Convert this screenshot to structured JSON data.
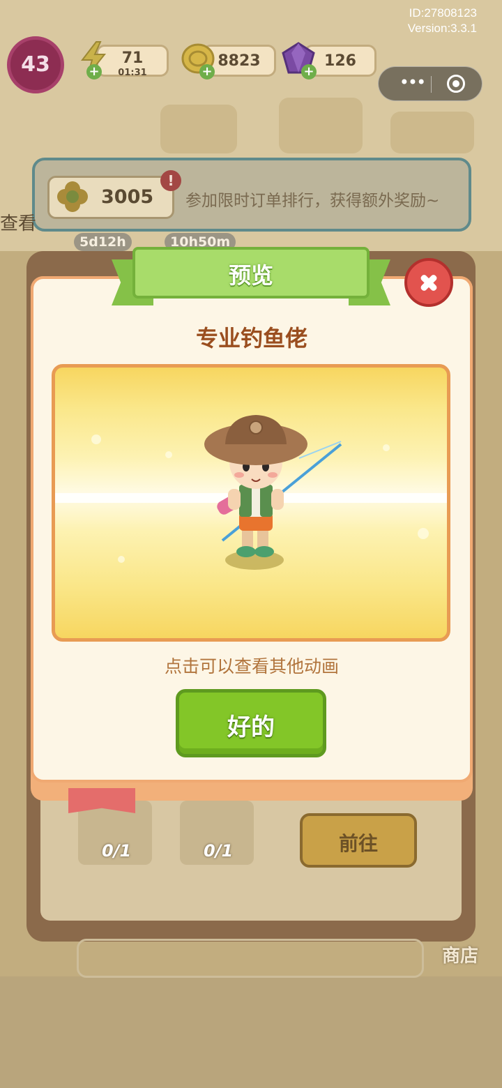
{
  "build": {
    "id": "ID:27808123",
    "version": "Version:3.3.1"
  },
  "hud": {
    "level": "43",
    "energy": "71",
    "energy_timer": "01:31",
    "coins": "8823",
    "gems": "126"
  },
  "mini_program": {
    "more_icon": "more-dots-icon",
    "close_icon": "target-circle-icon"
  },
  "banner": {
    "score": "3005",
    "alert": "!",
    "message": "参加限时订单排行，获得额外奖励~",
    "side_label": "查看",
    "timers": [
      "5d12h",
      "10h50m"
    ]
  },
  "background_panel": {
    "cards": [
      {
        "count": "0/1"
      },
      {
        "count": "0/1"
      }
    ],
    "go_button": "前往",
    "shop_label": "商店"
  },
  "modal": {
    "header": "预览",
    "title": "专业钓鱼佬",
    "hint": "点击可以查看其他动画",
    "ok_button": "好的"
  },
  "colors": {
    "accent_green": "#83c628",
    "modal_border": "#f0a972",
    "title_brown": "#9a4e1f",
    "close_red": "#e2534e"
  }
}
